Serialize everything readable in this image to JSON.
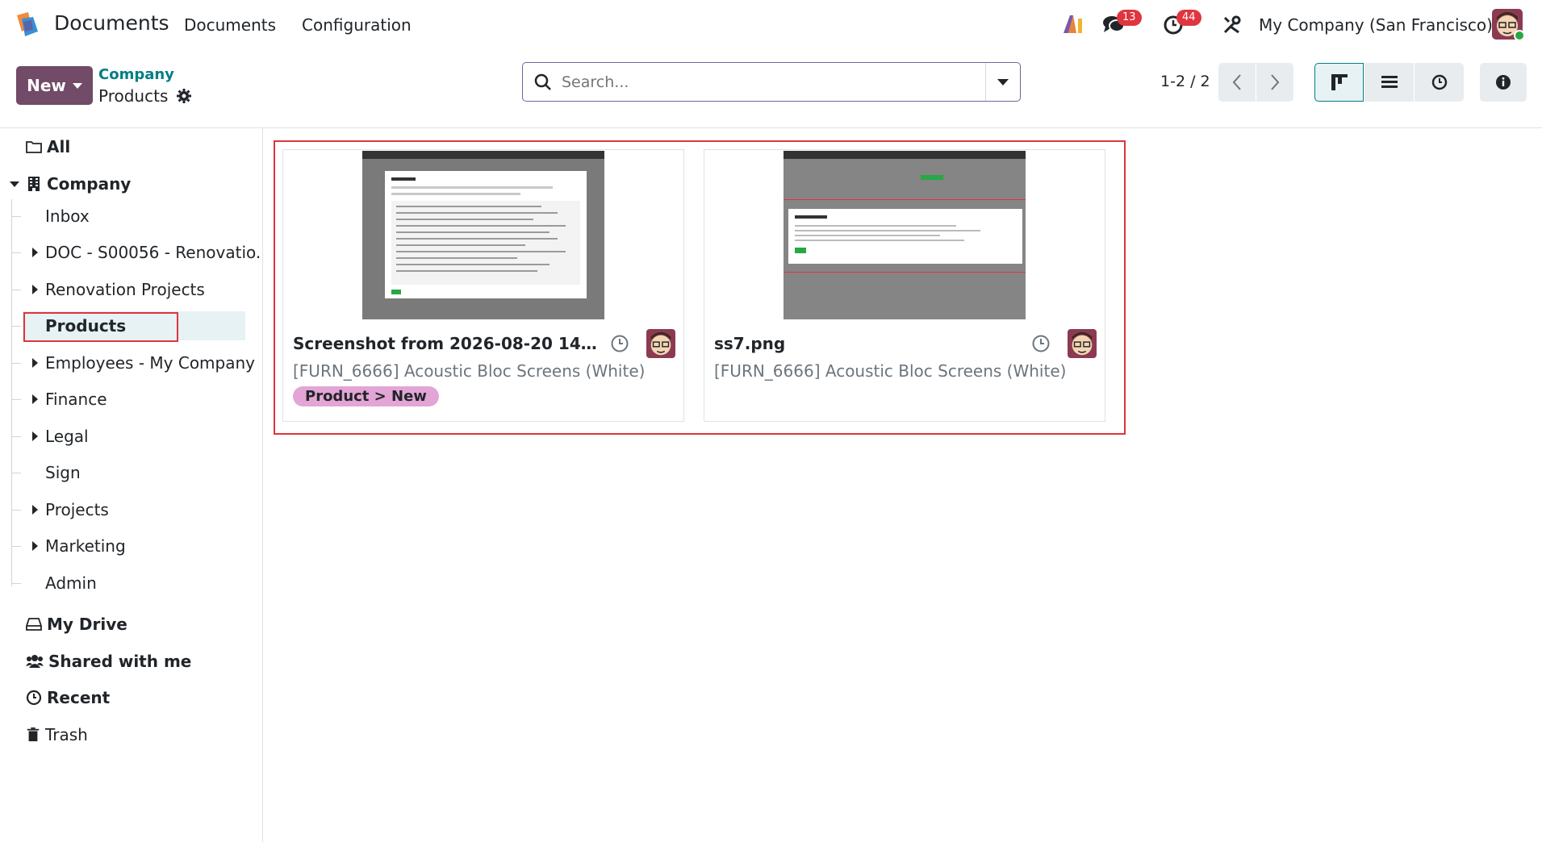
{
  "navbar": {
    "app_title": "Documents",
    "menu": [
      "Documents",
      "Configuration"
    ],
    "messages_badge": "13",
    "activities_badge": "44",
    "company": "My Company (San Francisco)"
  },
  "control_panel": {
    "new_label": "New",
    "breadcrumb_parent": "Company",
    "breadcrumb_current": "Products",
    "search_placeholder": "Search...",
    "pager": "1-2 / 2"
  },
  "sidebar": {
    "all": "All",
    "company": "Company",
    "children": [
      {
        "label": "Inbox",
        "expandable": false
      },
      {
        "label": "DOC - S00056 - Renovatio.",
        "expandable": true
      },
      {
        "label": "Renovation Projects",
        "expandable": true
      },
      {
        "label": "Products",
        "expandable": false,
        "selected": true
      },
      {
        "label": "Employees - My Company",
        "expandable": true
      },
      {
        "label": "Finance",
        "expandable": true
      },
      {
        "label": "Legal",
        "expandable": true
      },
      {
        "label": "Sign",
        "expandable": false
      },
      {
        "label": "Projects",
        "expandable": true
      },
      {
        "label": "Marketing",
        "expandable": true
      },
      {
        "label": "Admin",
        "expandable": false
      }
    ],
    "my_drive": "My Drive",
    "shared": "Shared with me",
    "recent": "Recent",
    "trash": "Trash"
  },
  "cards": [
    {
      "title": "Screenshot from 2026-08-20 14-11-...",
      "subtitle": "[FURN_6666] Acoustic Bloc Screens (White)",
      "tag": "Product > New"
    },
    {
      "title": "ss7.png",
      "subtitle": "[FURN_6666] Acoustic Bloc Screens (White)",
      "tag": ""
    }
  ],
  "colors": {
    "brand": "#714b67",
    "accent": "#017e84",
    "badge": "#e0343e",
    "tag": "#e3a5d6"
  }
}
